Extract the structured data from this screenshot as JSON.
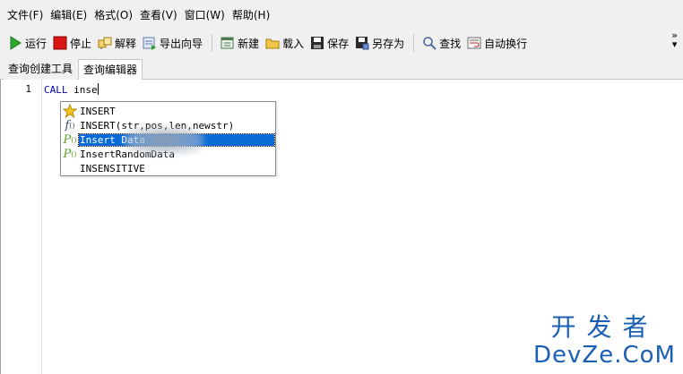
{
  "menu": {
    "items": [
      "文件(F)",
      "编辑(E)",
      "格式(O)",
      "查看(V)",
      "窗口(W)",
      "帮助(H)"
    ]
  },
  "toolbar": {
    "run": "运行",
    "stop": "停止",
    "explain": "解释",
    "export_wizard": "导出向导",
    "new": "新建",
    "load": "载入",
    "save": "保存",
    "save_as": "另存为",
    "find": "查找",
    "word_wrap": "自动换行",
    "more": "»"
  },
  "tabs": [
    {
      "label": "查询创建工具",
      "active": false
    },
    {
      "label": "查询编辑器",
      "active": true
    }
  ],
  "editor": {
    "line_number": "1",
    "keyword": "CALL",
    "typed": " inse"
  },
  "autocomplete": {
    "items": [
      {
        "icon": "star-icon",
        "label": "INSERT",
        "selected": false
      },
      {
        "icon": "function-icon",
        "label": "INSERT(str,pos,len,newstr)",
        "selected": false
      },
      {
        "icon": "procedure-icon",
        "label": "Insert          Data",
        "selected": true
      },
      {
        "icon": "procedure-icon",
        "label": "InsertRandomData",
        "selected": false
      },
      {
        "icon": "",
        "label": "INSENSITIVE",
        "selected": false
      }
    ]
  },
  "watermark": {
    "top": "开发者",
    "bottom": "DevZe.CoM"
  },
  "colors": {
    "selection": "#0a6ad8",
    "keyword": "#0000c0",
    "watermark": "#1a5fb4"
  }
}
